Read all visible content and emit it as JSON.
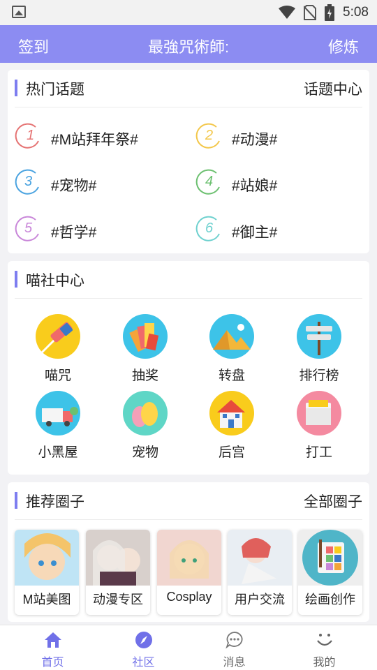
{
  "status_bar": {
    "time": "5:08"
  },
  "header": {
    "left": "签到",
    "title": "最強咒術師:",
    "right": "修炼"
  },
  "hot_topics": {
    "title": "热门话题",
    "link": "话题中心",
    "items": [
      {
        "rank": "1",
        "text": "#M站拜年祭#",
        "color": "#e57373"
      },
      {
        "rank": "2",
        "text": "#动漫#",
        "color": "#f3c74a"
      },
      {
        "rank": "3",
        "text": "#宠物#",
        "color": "#4aa3e0"
      },
      {
        "rank": "4",
        "text": "#站娘#",
        "color": "#6cc070"
      },
      {
        "rank": "5",
        "text": "#哲学#",
        "color": "#c987d9"
      },
      {
        "rank": "6",
        "text": "#御主#",
        "color": "#6fd1cf"
      }
    ]
  },
  "center": {
    "title": "喵社中心",
    "items": [
      {
        "label": "喵咒",
        "icon": "eraser-icon"
      },
      {
        "label": "抽奖",
        "icon": "color-swatch-icon"
      },
      {
        "label": "转盘",
        "icon": "pyramid-icon"
      },
      {
        "label": "排行榜",
        "icon": "signpost-icon"
      },
      {
        "label": "小黑屋",
        "icon": "truck-icon"
      },
      {
        "label": "宠物",
        "icon": "egg-icon"
      },
      {
        "label": "后宫",
        "icon": "house-icon"
      },
      {
        "label": "打工",
        "icon": "folder-icon"
      }
    ]
  },
  "circles": {
    "title": "推荐圈子",
    "link": "全部圈子",
    "items": [
      {
        "label": "M站美图"
      },
      {
        "label": "动漫专区"
      },
      {
        "label": "Cosplay"
      },
      {
        "label": "用户交流"
      },
      {
        "label": "绘画创作"
      }
    ]
  },
  "bottom_nav": {
    "items": [
      {
        "label": "首页",
        "icon": "home-icon",
        "active": true
      },
      {
        "label": "社区",
        "icon": "compass-icon",
        "active": true
      },
      {
        "label": "消息",
        "icon": "chat-icon",
        "active": false
      },
      {
        "label": "我的",
        "icon": "smile-icon",
        "active": false
      }
    ]
  },
  "colors": {
    "accent": "#8c8cf2",
    "nav_active": "#7070e8"
  }
}
